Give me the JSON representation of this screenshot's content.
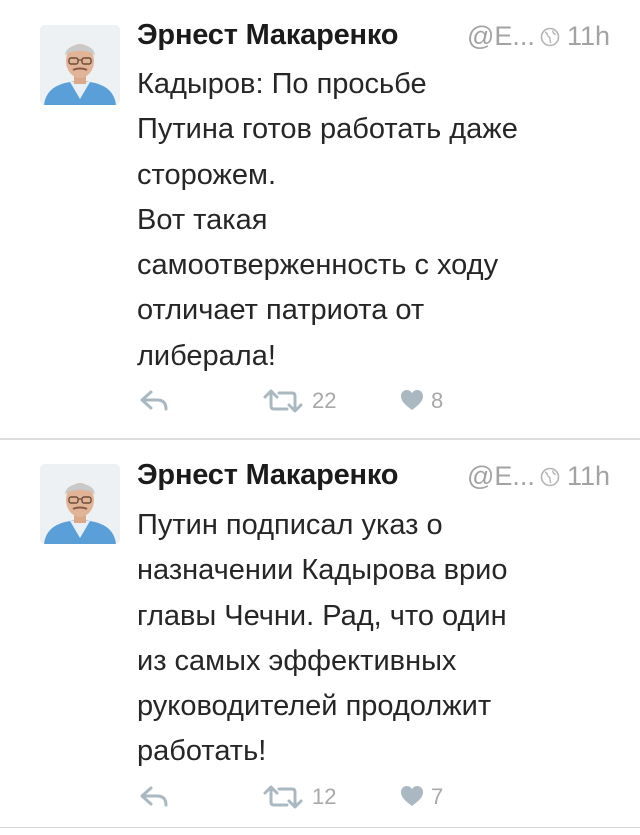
{
  "tweets": [
    {
      "author_name": "Эрнест Макаренко",
      "author_handle": "@Е...",
      "timestamp": "11h",
      "text_lines": [
        "Кадыров: По просьбе",
        "Путина готов работать даже",
        "сторожем.",
        "Вот такая",
        "самоотверженность с ходу",
        "отличает патриота от",
        "либерала!"
      ],
      "retweet_count": "22",
      "like_count": "8"
    },
    {
      "author_name": "Эрнест Макаренко",
      "author_handle": "@Е...",
      "timestamp": "11h",
      "text_lines": [
        "Путин подписал указ о",
        "назначении Кадырова врио",
        "главы Чечни. Рад, что один",
        "из самых эффективных",
        "руководителей продолжит",
        "работать!"
      ],
      "retweet_count": "12",
      "like_count": "7"
    }
  ],
  "icons": {
    "reply": "reply-icon",
    "retweet": "retweet-icon",
    "like": "heart-icon",
    "visibility": "globe-icon"
  },
  "colors": {
    "text": "#262626",
    "name": "#1b1b1b",
    "muted": "#a3a3a3",
    "icon": "#aab8c2",
    "divider": "#dcdcdc"
  }
}
